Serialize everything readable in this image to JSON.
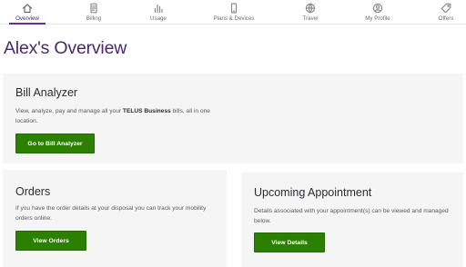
{
  "nav": {
    "items": [
      {
        "label": "Overview",
        "icon": "home-icon",
        "active": true
      },
      {
        "label": "Billing",
        "icon": "bill-icon"
      },
      {
        "label": "Usage",
        "icon": "usage-bars-icon"
      },
      {
        "label": "Plans & Devices",
        "icon": "phone-icon"
      },
      {
        "label": "Travel",
        "icon": "globe-icon"
      },
      {
        "label": "My Profile",
        "icon": "profile-icon"
      },
      {
        "label": "Offers",
        "icon": "tag-icon"
      }
    ]
  },
  "page": {
    "title": "Alex's Overview"
  },
  "bill_analyzer": {
    "title": "Bill Analyzer",
    "text_before": "View, analyze, pay and manage all your ",
    "text_bold": "TELUS Business",
    "text_after": " bills, all in one location.",
    "button": "Go to Bill Analyzer"
  },
  "orders": {
    "title": "Orders",
    "text": "If you have the order details at your disposal you can track your mobility orders online.",
    "button": "View Orders"
  },
  "appointment": {
    "title": "Upcoming Appointment",
    "text": "Details associated with your appointment(s) can be viewed and managed below.",
    "button": "View Details"
  },
  "colors": {
    "brand_purple": "#4b286d",
    "button_green": "#2b8000",
    "card_background": "#f5f5f5"
  }
}
